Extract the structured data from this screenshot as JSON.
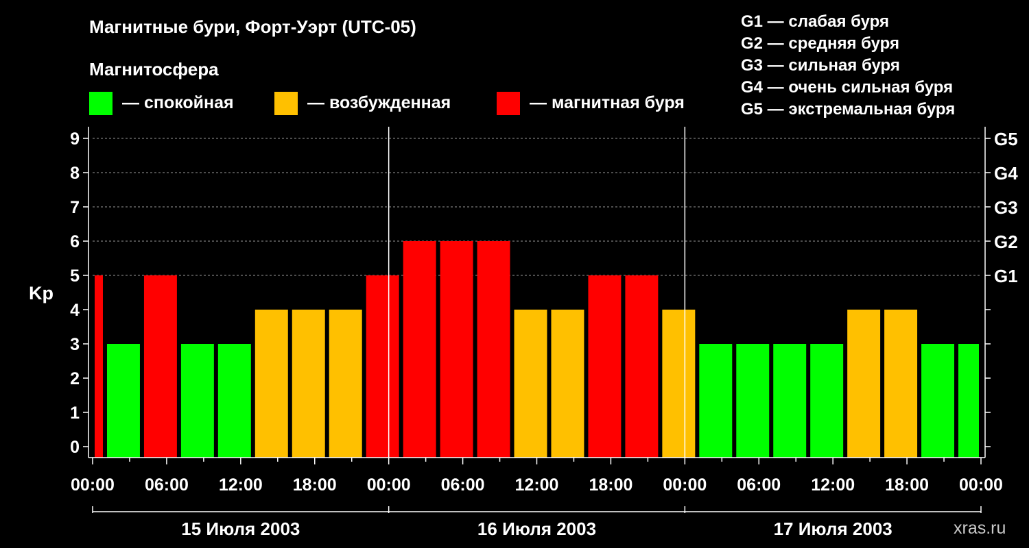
{
  "chart_data": {
    "type": "bar",
    "title": "Магнитные бури, Форт-Уэрт (UTC-05)",
    "subtitle": "Магнитосфера",
    "ylabel": "Kp",
    "ylim": [
      0,
      9
    ],
    "yticks": [
      "0",
      "1",
      "2",
      "3",
      "4",
      "5",
      "6",
      "7",
      "8",
      "9"
    ],
    "storm_levels": [
      {
        "label": "G1",
        "kp": 5
      },
      {
        "label": "G2",
        "kp": 6
      },
      {
        "label": "G3",
        "kp": 7
      },
      {
        "label": "G4",
        "kp": 8
      },
      {
        "label": "G5",
        "kp": 9
      }
    ],
    "xticks": [
      "00:00",
      "06:00",
      "12:00",
      "18:00",
      "00:00",
      "06:00",
      "12:00",
      "18:00",
      "00:00",
      "06:00",
      "12:00",
      "18:00",
      "00:00"
    ],
    "days": [
      "15 Июля 2003",
      "16 Июля 2003",
      "17 Июля 2003"
    ],
    "interval_hours": 3,
    "first_bar_start_hour": -2,
    "values": [
      5,
      3,
      5,
      3,
      3,
      4,
      4,
      4,
      5,
      6,
      6,
      6,
      4,
      4,
      5,
      5,
      4,
      3,
      3,
      3,
      3,
      4,
      4,
      3,
      3
    ],
    "grid": true,
    "legend": [
      {
        "label": "— спокойная",
        "color": "#00ff00"
      },
      {
        "label": "— возбужденная",
        "color": "#ffc000"
      },
      {
        "label": "— магнитная буря",
        "color": "#ff0000"
      }
    ],
    "colors": {
      "calm": "#00ff00",
      "active": "#ffc000",
      "storm": "#ff0000"
    }
  },
  "storm_legend": [
    "G1 — слабая буря",
    "G2 — средняя буря",
    "G3 — сильная буря",
    "G4 — очень сильная буря",
    "G5 — экстремальная буря"
  ],
  "watermark": "xras.ru"
}
